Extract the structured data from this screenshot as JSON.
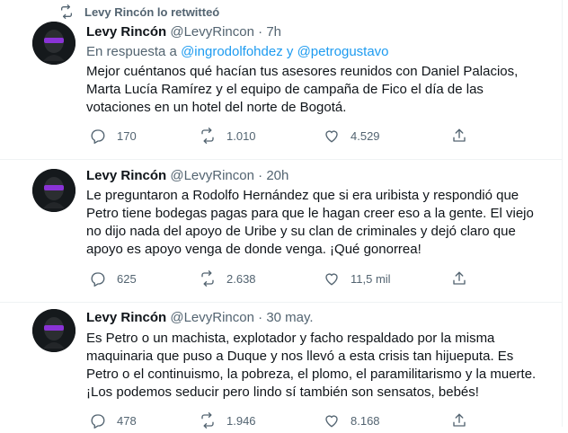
{
  "timeline": {
    "tweets": [
      {
        "retweet_label": "Levy Rincón lo retwitteó",
        "name": "Levy Rincón",
        "handle": "@LevyRincon",
        "dot": "·",
        "time": "7h",
        "reply_prefix": "En respuesta a",
        "reply_user1": "@ingrodolfohdez",
        "reply_and": "y",
        "reply_user2": "@petrogustavo",
        "lines": [
          "Mejor cuéntanos qué hacían tus asesores reunidos con Daniel Palacios,",
          "Marta Lucía Ramírez y el equipo de campaña de Fico el día de las",
          "votaciones en un hotel del norte de Bogotá."
        ],
        "replies": "170",
        "retweets": "1.010",
        "likes": "4.529"
      },
      {
        "name": "Levy Rincón",
        "handle": "@LevyRincon",
        "dot": "·",
        "time": "20h",
        "lines": [
          "Le preguntaron a Rodolfo Hernández que si era uribista y respondió que",
          "Petro tiene bodegas pagas para que le hagan creer eso a la gente. El viejo",
          "no dijo nada del apoyo de Uribe y su clan de criminales y dejó claro que",
          "apoyo es apoyo venga de donde venga. ¡Qué gonorrea!"
        ],
        "replies": "625",
        "retweets": "2.638",
        "likes": "11,5 mil"
      },
      {
        "name": "Levy Rincón",
        "handle": "@LevyRincon",
        "dot": "·",
        "time": "30 may.",
        "lines": [
          "Es Petro o un machista, explotador y facho respaldado por la misma",
          "maquinaria que puso a Duque y nos llevó a esta crisis tan hijueputa. Es",
          "Petro o el continuismo, la pobreza, el plomo, el paramilitarismo y la muerte.",
          "¡Los podemos seducir pero lindo sí también son sensatos, bebés!"
        ],
        "replies": "478",
        "retweets": "1.946",
        "likes": "8.168"
      }
    ]
  },
  "colors": {
    "text": "#0f1419",
    "secondary": "#536471",
    "link": "#1d9bf0",
    "border": "#eff3f4",
    "avatar_accent": "#8a33d6"
  }
}
